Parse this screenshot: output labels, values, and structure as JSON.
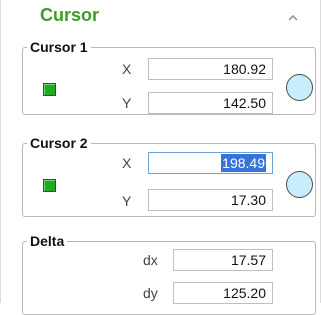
{
  "panel": {
    "title": "Cursor"
  },
  "cursor1": {
    "legend": "Cursor 1",
    "x_label": "X",
    "x_value": "180.92",
    "y_label": "Y",
    "y_value": "142.50",
    "color": "#1fab1f"
  },
  "cursor2": {
    "legend": "Cursor 2",
    "x_label": "X",
    "x_value": "198.49",
    "y_label": "Y",
    "y_value": "17.30",
    "color": "#1fab1f"
  },
  "delta": {
    "legend": "Delta",
    "dx_label": "dx",
    "dx_value": "17.57",
    "dy_label": "dy",
    "dy_value": "125.20"
  },
  "colors": {
    "title": "#3f9b2a",
    "selection": "#3874d8",
    "circle_fill": "#c9eefb"
  }
}
